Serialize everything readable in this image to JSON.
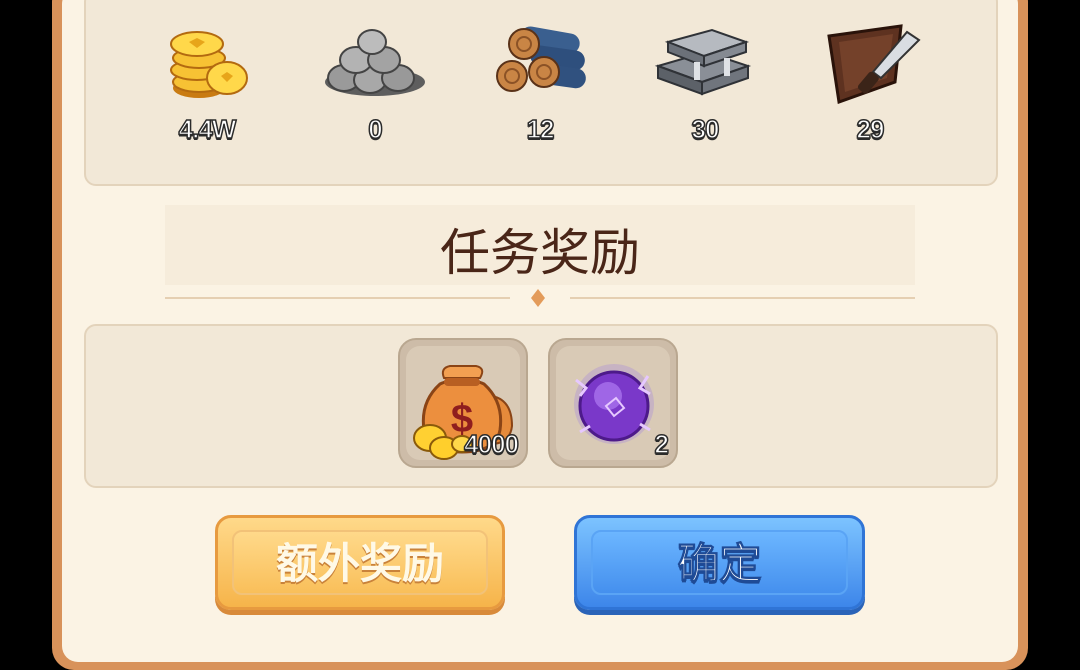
{
  "resources": [
    {
      "name": "gold-coins",
      "icon": "coin-stack-icon",
      "value": "4.4W"
    },
    {
      "name": "stone",
      "icon": "stone-pile-icon",
      "value": "0"
    },
    {
      "name": "wood",
      "icon": "log-pile-icon",
      "value": "12"
    },
    {
      "name": "iron",
      "icon": "iron-ingot-icon",
      "value": "30"
    },
    {
      "name": "leather",
      "icon": "leather-knife-icon",
      "value": "29"
    }
  ],
  "section_title": "任务奖励",
  "rewards": [
    {
      "icon": "money-bag-icon",
      "count": "4000"
    },
    {
      "icon": "purple-orb-icon",
      "count": "2"
    }
  ],
  "buttons": {
    "extra": "额外奖励",
    "confirm": "确定"
  },
  "colors": {
    "frame": "#d8925a",
    "panel": "#fbf3e4",
    "title_text": "#4a2618",
    "extra_button": "#f6b44a",
    "confirm_button": "#3d86ea"
  }
}
